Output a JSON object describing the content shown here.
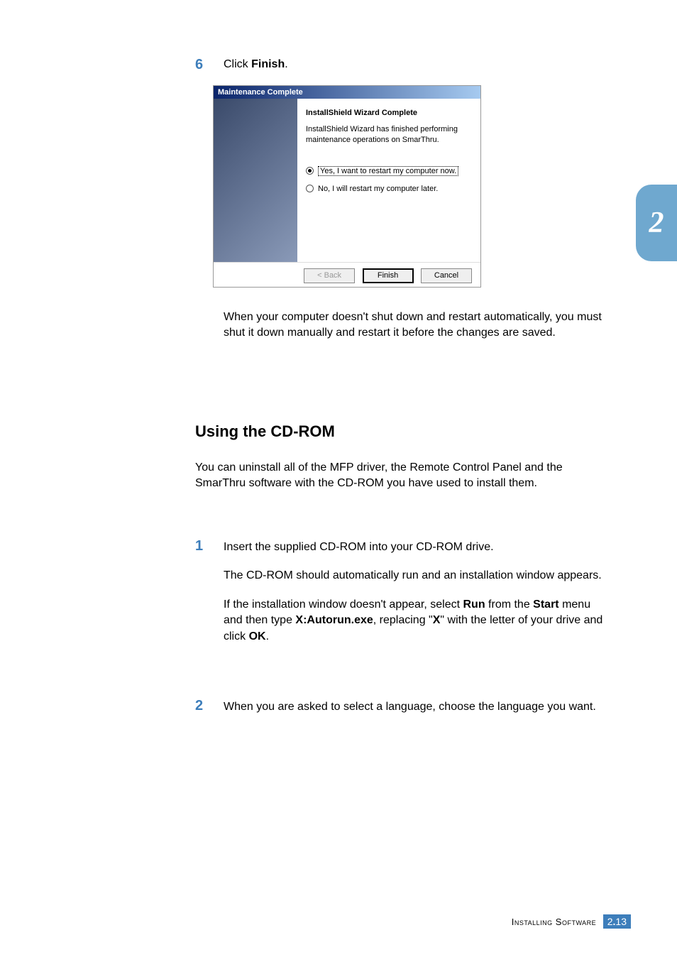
{
  "instruction6": {
    "number": "6",
    "click": "Click ",
    "finish": "Finish",
    "period": "."
  },
  "dialog": {
    "title": "Maintenance Complete",
    "heading": "InstallShield Wizard Complete",
    "paragraph": "InstallShield Wizard has finished performing maintenance operations on SmarThru.",
    "radio1": "Yes, I want to restart my computer now.",
    "radio2": "No, I will restart my computer later.",
    "buttons": {
      "back": "< Back",
      "finish": "Finish",
      "cancel": "Cancel"
    }
  },
  "after_dialog_para": "When your computer doesn't shut down and restart automatically, you must shut it down manually and restart it before the changes are saved.",
  "section_heading": "Using the CD-ROM",
  "section_intro": "You can uninstall all of the MFP driver, the Remote Control Panel and the SmarThru software with the CD-ROM you have used to install them.",
  "step1": {
    "number": "1",
    "p1": "Insert the supplied CD-ROM into your CD-ROM drive.",
    "p2": "The CD-ROM should automatically run and an installation window appears.",
    "p3a": "If the installation window doesn't appear, select ",
    "p3b_run": "Run",
    "p3c": " from the ",
    "p3d_start": "Start",
    "p3e": " menu and then type ",
    "p3f_autorun": "X:Autorun.exe",
    "p3g": ", replacing \"",
    "p3h_x": "X",
    "p3i": "\" with the letter of your drive and click ",
    "p3j_ok": "OK",
    "p3k": "."
  },
  "step2": {
    "number": "2",
    "text": "When you are asked to select a language, choose the language you want."
  },
  "chapter_tab": "2",
  "footer": {
    "label": "Installing Software",
    "page_chapter": "2",
    "page_dot": ".",
    "page_num": "13"
  }
}
